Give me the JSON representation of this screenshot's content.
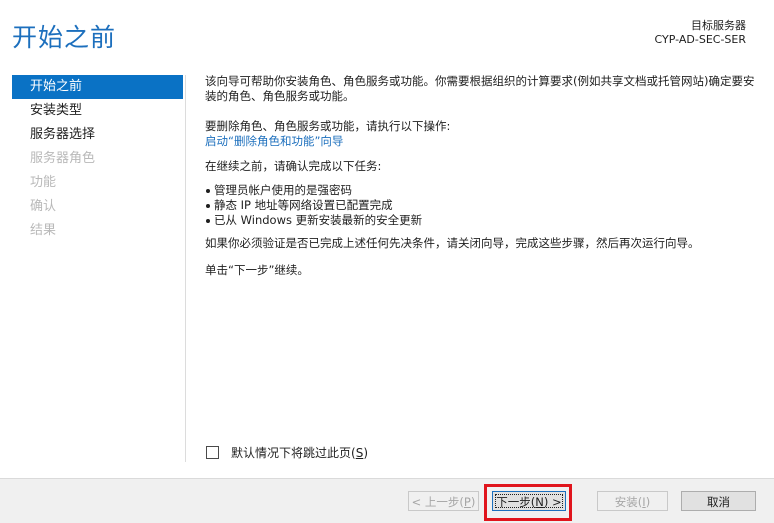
{
  "header": {
    "title": "开始之前",
    "target_label": "目标服务器",
    "target_name": "CYP-AD-SEC-SER"
  },
  "nav": {
    "items": [
      {
        "label": "开始之前",
        "state": "active"
      },
      {
        "label": "安装类型",
        "state": "enabled"
      },
      {
        "label": "服务器选择",
        "state": "enabled"
      },
      {
        "label": "服务器角色",
        "state": "disabled"
      },
      {
        "label": "功能",
        "state": "disabled"
      },
      {
        "label": "确认",
        "state": "disabled"
      },
      {
        "label": "结果",
        "state": "disabled"
      }
    ]
  },
  "content": {
    "intro": "该向导可帮助你安装角色、角色服务或功能。你需要根据组织的计算要求(例如共享文档或托管网站)确定要安装的角色、角色服务或功能。",
    "remove_heading": "要删除角色、角色服务或功能，请执行以下操作:",
    "remove_link": "启动“删除角色和功能”向导",
    "before_heading": "在继续之前，请确认完成以下任务:",
    "tasks": [
      "管理员帐户使用的是强密码",
      "静态 IP 地址等网络设置已配置完成",
      "已从 Windows 更新安装最新的安全更新"
    ],
    "verify_text": "如果你必须验证是否已完成上述任何先决条件，请关闭向导，完成这些步骤，然后再次运行向导。",
    "next_hint": "单击“下一步”继续。"
  },
  "skip": {
    "label": "默认情况下将跳过此页",
    "accel": "S",
    "checked": false
  },
  "buttons": {
    "prev": {
      "label": "< 上一步(",
      "accel": "P",
      "suffix": ")",
      "enabled": false
    },
    "next": {
      "label": "下一步(",
      "accel": "N",
      "suffix": ") >",
      "enabled": true
    },
    "install": {
      "label": "安装(",
      "accel": "I",
      "suffix": ")",
      "enabled": false
    },
    "cancel": {
      "label": "取消",
      "enabled": true
    }
  },
  "colors": {
    "accent": "#1c6fbd",
    "nav_active": "#0a72c5",
    "highlight": "#e0141c"
  }
}
